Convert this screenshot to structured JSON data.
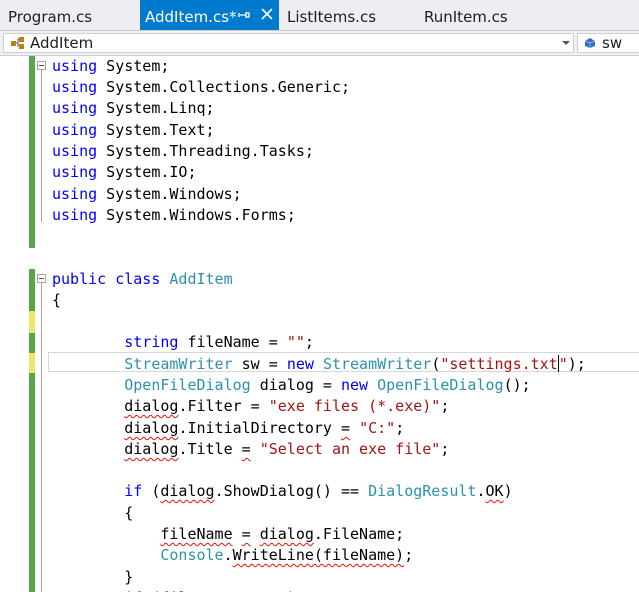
{
  "tabs": [
    {
      "label": "Program.cs",
      "active": false
    },
    {
      "label": "AddItem.cs*",
      "active": true
    },
    {
      "label": "ListItems.cs",
      "active": false
    },
    {
      "label": "RunItem.cs",
      "active": false
    }
  ],
  "navbar": {
    "type_selector": "AddItem",
    "member_selector": "sw"
  },
  "colors": {
    "keyword": "#0000ff",
    "type": "#2b91af",
    "string": "#a31515",
    "squiggle": "#e51400",
    "active_tab": "#007acc",
    "saved_change": "#57a64a",
    "unsaved_change": "#efe56b"
  },
  "code_lines": [
    {
      "ln": 1,
      "segments": [
        {
          "t": "using",
          "k": "kw"
        },
        {
          "t": " System;"
        }
      ]
    },
    {
      "ln": 2,
      "segments": [
        {
          "t": "using",
          "k": "kw"
        },
        {
          "t": " System.Collections.Generic;"
        }
      ]
    },
    {
      "ln": 3,
      "segments": [
        {
          "t": "using",
          "k": "kw"
        },
        {
          "t": " System.Linq;"
        }
      ]
    },
    {
      "ln": 4,
      "segments": [
        {
          "t": "using",
          "k": "kw"
        },
        {
          "t": " System.Text;"
        }
      ]
    },
    {
      "ln": 5,
      "segments": [
        {
          "t": "using",
          "k": "kw"
        },
        {
          "t": " System.Threading.Tasks;"
        }
      ]
    },
    {
      "ln": 6,
      "segments": [
        {
          "t": "using",
          "k": "kw"
        },
        {
          "t": " System.IO;"
        }
      ]
    },
    {
      "ln": 7,
      "segments": [
        {
          "t": "using",
          "k": "kw"
        },
        {
          "t": " System.Windows;"
        }
      ]
    },
    {
      "ln": 8,
      "segments": [
        {
          "t": "using",
          "k": "kw"
        },
        {
          "t": " System.Windows.Forms;"
        }
      ]
    },
    {
      "ln": 9,
      "segments": []
    },
    {
      "ln": 10,
      "segments": []
    },
    {
      "ln": 11,
      "segments": [
        {
          "t": "public",
          "k": "kw"
        },
        {
          "t": " "
        },
        {
          "t": "class",
          "k": "kw"
        },
        {
          "t": " "
        },
        {
          "t": "AddItem",
          "k": "ty"
        }
      ]
    },
    {
      "ln": 12,
      "segments": [
        {
          "t": "{"
        }
      ]
    },
    {
      "ln": 13,
      "segments": []
    },
    {
      "ln": 14,
      "segments": [
        {
          "t": "        "
        },
        {
          "t": "string",
          "k": "kw"
        },
        {
          "t": " fileName = "
        },
        {
          "t": "\"\"",
          "k": "str"
        },
        {
          "t": ";"
        }
      ]
    },
    {
      "ln": 15,
      "segments": [
        {
          "t": "        "
        },
        {
          "t": "StreamWriter",
          "k": "ty"
        },
        {
          "t": " sw = "
        },
        {
          "t": "new",
          "k": "kw"
        },
        {
          "t": " "
        },
        {
          "t": "StreamWriter",
          "k": "ty"
        },
        {
          "t": "("
        },
        {
          "t": "\"settings.txt",
          "k": "str"
        },
        {
          "t": "",
          "caret": true
        },
        {
          "t": "\"",
          "k": "str"
        },
        {
          "t": ");"
        }
      ]
    },
    {
      "ln": 16,
      "segments": [
        {
          "t": "        "
        },
        {
          "t": "OpenFileDialog",
          "k": "ty"
        },
        {
          "t": " dialog = "
        },
        {
          "t": "new",
          "k": "kw"
        },
        {
          "t": " "
        },
        {
          "t": "OpenFileDialog",
          "k": "ty"
        },
        {
          "t": "();"
        }
      ]
    },
    {
      "ln": 17,
      "segments": [
        {
          "t": "        "
        },
        {
          "t": "dialog",
          "sq": true
        },
        {
          "t": ".Filter = "
        },
        {
          "t": "\"exe files (*.exe)\"",
          "k": "str"
        },
        {
          "t": ";"
        }
      ]
    },
    {
      "ln": 18,
      "segments": [
        {
          "t": "        "
        },
        {
          "t": "dialog",
          "sq": true
        },
        {
          "t": ".InitialDirectory "
        },
        {
          "t": "=",
          "sq": true
        },
        {
          "t": " "
        },
        {
          "t": "\"C:\"",
          "k": "str"
        },
        {
          "t": ";"
        }
      ]
    },
    {
      "ln": 19,
      "segments": [
        {
          "t": "        "
        },
        {
          "t": "dialog",
          "sq": true
        },
        {
          "t": ".Title "
        },
        {
          "t": "=",
          "sq": true
        },
        {
          "t": " "
        },
        {
          "t": "\"Select an exe file\"",
          "k": "str"
        },
        {
          "t": ";"
        }
      ]
    },
    {
      "ln": 20,
      "segments": []
    },
    {
      "ln": 21,
      "segments": [
        {
          "t": "        "
        },
        {
          "t": "if",
          "k": "kw"
        },
        {
          "t": " ("
        },
        {
          "t": "dialog",
          "sq": true
        },
        {
          "t": ".ShowDialog() == "
        },
        {
          "t": "DialogResult",
          "k": "ty"
        },
        {
          "t": "."
        },
        {
          "t": "OK",
          "sq": true
        },
        {
          "t": ")"
        }
      ]
    },
    {
      "ln": 22,
      "segments": [
        {
          "t": "        {"
        }
      ]
    },
    {
      "ln": 23,
      "segments": [
        {
          "t": "            "
        },
        {
          "t": "fileName",
          "sq": true
        },
        {
          "t": " "
        },
        {
          "t": "=",
          "sq": true
        },
        {
          "t": " "
        },
        {
          "t": "dialog",
          "sq": true
        },
        {
          "t": ".FileName;"
        }
      ]
    },
    {
      "ln": 24,
      "segments": [
        {
          "t": "            "
        },
        {
          "t": "Console",
          "k": "ty"
        },
        {
          "t": "."
        },
        {
          "t": "WriteLine(fileName)",
          "sq": true
        },
        {
          "t": ";"
        }
      ]
    },
    {
      "ln": 25,
      "segments": [
        {
          "t": "        }"
        }
      ]
    },
    {
      "ln": 26,
      "segments": [
        {
          "t": "        "
        },
        {
          "t": "if",
          "k": "kw"
        },
        {
          "t": " (fileName "
        },
        {
          "t": "==",
          "sq": true
        },
        {
          "t": " "
        },
        {
          "t": "\"\"",
          "k": "str"
        },
        {
          "t": ")"
        }
      ]
    }
  ]
}
